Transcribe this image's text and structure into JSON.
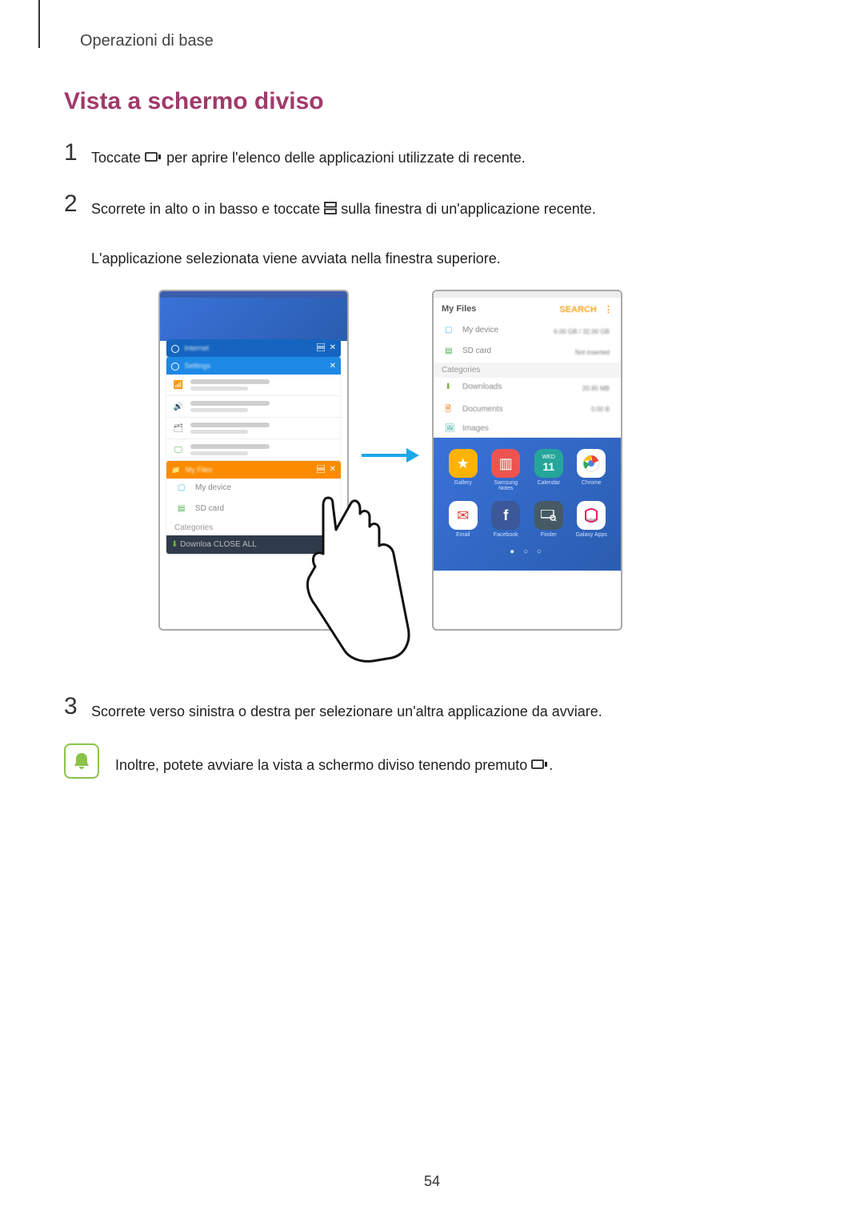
{
  "header": {
    "breadcrumb": "Operazioni di base"
  },
  "page_number": "54",
  "section": {
    "title": "Vista a schermo diviso"
  },
  "steps": {
    "s1": {
      "num": "1",
      "before": "Toccate ",
      "after": " per aprire l'elenco delle applicazioni utilizzate di recente."
    },
    "s2": {
      "num": "2",
      "before": "Scorrete in alto o in basso e toccate ",
      "after": " sulla finestra di un'applicazione recente.",
      "line2": "L'applicazione selezionata viene avviata nella finestra superiore."
    },
    "s3": {
      "num": "3",
      "text": "Scorrete verso sinistra o destra per selezionare un'altra applicazione da avviare."
    }
  },
  "tip": {
    "before": "Inoltre, potete avviare la vista a schermo diviso tenendo premuto ",
    "after": "."
  },
  "left_phone": {
    "recent1": "Internet",
    "recent2": "Settings",
    "recent3": "My Files",
    "row_connections": "Connections",
    "row_sounds": "Sounds and vibration",
    "row_notif": "Notifications",
    "row_display": "Display",
    "file_mydevice": "My device",
    "file_sdcard": "SD card",
    "categories": "Categories",
    "close_all": "Downloa CLOSE ALL"
  },
  "right_phone": {
    "title": "My Files",
    "search": "SEARCH",
    "dots": "⋮",
    "file_mydevice": "My device",
    "file_mydevice_info": "6.00 GB / 32.00 GB",
    "file_sdcard": "SD card",
    "file_sdcard_info": "Not inserted",
    "categories": "Categories",
    "row_downloads": "Downloads",
    "row_downloads_info": "20.95 MB",
    "row_documents": "Documents",
    "row_documents_info": "0.00 B",
    "row_images": "Images",
    "apps": {
      "a1": "Gallery",
      "a2": "Samsung Notes",
      "a3": "Calendar",
      "a4": "Chrome",
      "a5": "Email",
      "a6": "Facebook",
      "a7": "Finder",
      "a8": "Galaxy Apps",
      "cal_day": "11",
      "cal_top": "WED"
    },
    "pager": "●  ○  ○"
  }
}
